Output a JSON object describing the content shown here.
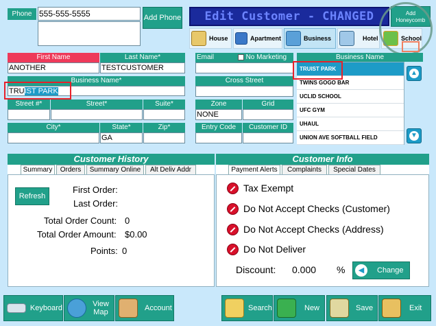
{
  "header": {
    "phone_label": "Phone",
    "phone_value": "555-555-5555",
    "add_phone_label": "Add Phone",
    "title": "Edit Customer - CHANGED",
    "add_honeycomb_label": "Add Honeycomb"
  },
  "address_types": [
    {
      "label": "House"
    },
    {
      "label": "Apartment"
    },
    {
      "label": "Business"
    },
    {
      "label": "Hotel"
    },
    {
      "label": "School"
    }
  ],
  "form": {
    "first_name_label": "First Name",
    "first_name_value": "ANOTHER",
    "last_name_label": "Last Name*",
    "last_name_value": "TESTCUSTOMER",
    "email_label": "Email",
    "no_marketing_label": "No Marketing",
    "business_name_label": "Business Name*",
    "business_name_typed": "TRU",
    "business_name_selected": "IST PARK",
    "cross_street_label": "Cross Street",
    "street_num_label": "Street #*",
    "street_label": "Street*",
    "suite_label": "Suite*",
    "zone_label": "Zone",
    "zone_value": "NONE",
    "grid_label": "Grid",
    "city_label": "City*",
    "state_label": "State*",
    "state_value": "GA",
    "zip_label": "Zip*",
    "entry_code_label": "Entry Code",
    "customer_id_label": "Customer ID"
  },
  "business_list": {
    "header": "Business Name",
    "items": [
      {
        "label": "TRUIST PARK"
      },
      {
        "label": "TWINS GOGO BAR"
      },
      {
        "label": "UCLID SCHOOL"
      },
      {
        "label": "UFC GYM"
      },
      {
        "label": "UHAUL"
      },
      {
        "label": "UNION AVE SOFTBALL FIELD"
      }
    ]
  },
  "history": {
    "title": "Customer History",
    "tabs": [
      {
        "label": "Summary"
      },
      {
        "label": "Orders"
      },
      {
        "label": "Summary Online"
      },
      {
        "label": "Alt Deliv Addr"
      }
    ],
    "refresh_label": "Refresh",
    "first_order_label": "First Order:",
    "last_order_label": "Last Order:",
    "total_count_label": "Total Order Count:",
    "total_count_value": "0",
    "total_amount_label": "Total Order Amount:",
    "total_amount_value": "$0.00",
    "points_label": "Points:",
    "points_value": "0"
  },
  "info": {
    "title": "Customer Info",
    "tabs": [
      {
        "label": "Payment Alerts"
      },
      {
        "label": "Complaints"
      },
      {
        "label": "Special Dates"
      }
    ],
    "lines": [
      {
        "label": "Tax Exempt"
      },
      {
        "label": "Do Not Accept Checks (Customer)"
      },
      {
        "label": "Do Not Accept Checks (Address)"
      },
      {
        "label": "Do Not Deliver"
      }
    ],
    "discount_label": "Discount:",
    "discount_value": "0.000",
    "percent_label": "%",
    "change_label": "Change"
  },
  "bottom": {
    "keyboard_label": "Keyboard",
    "view_map_label": "View Map",
    "account_label": "Account",
    "search_label": "Search",
    "new_label": "New",
    "save_label": "Save",
    "exit_label": "Exit"
  },
  "colors": {
    "accent": "#21a08a",
    "highlight_red": "#ee3a5a",
    "title_bg": "#1a2a9c",
    "selected_row": "#1d9bc7"
  }
}
